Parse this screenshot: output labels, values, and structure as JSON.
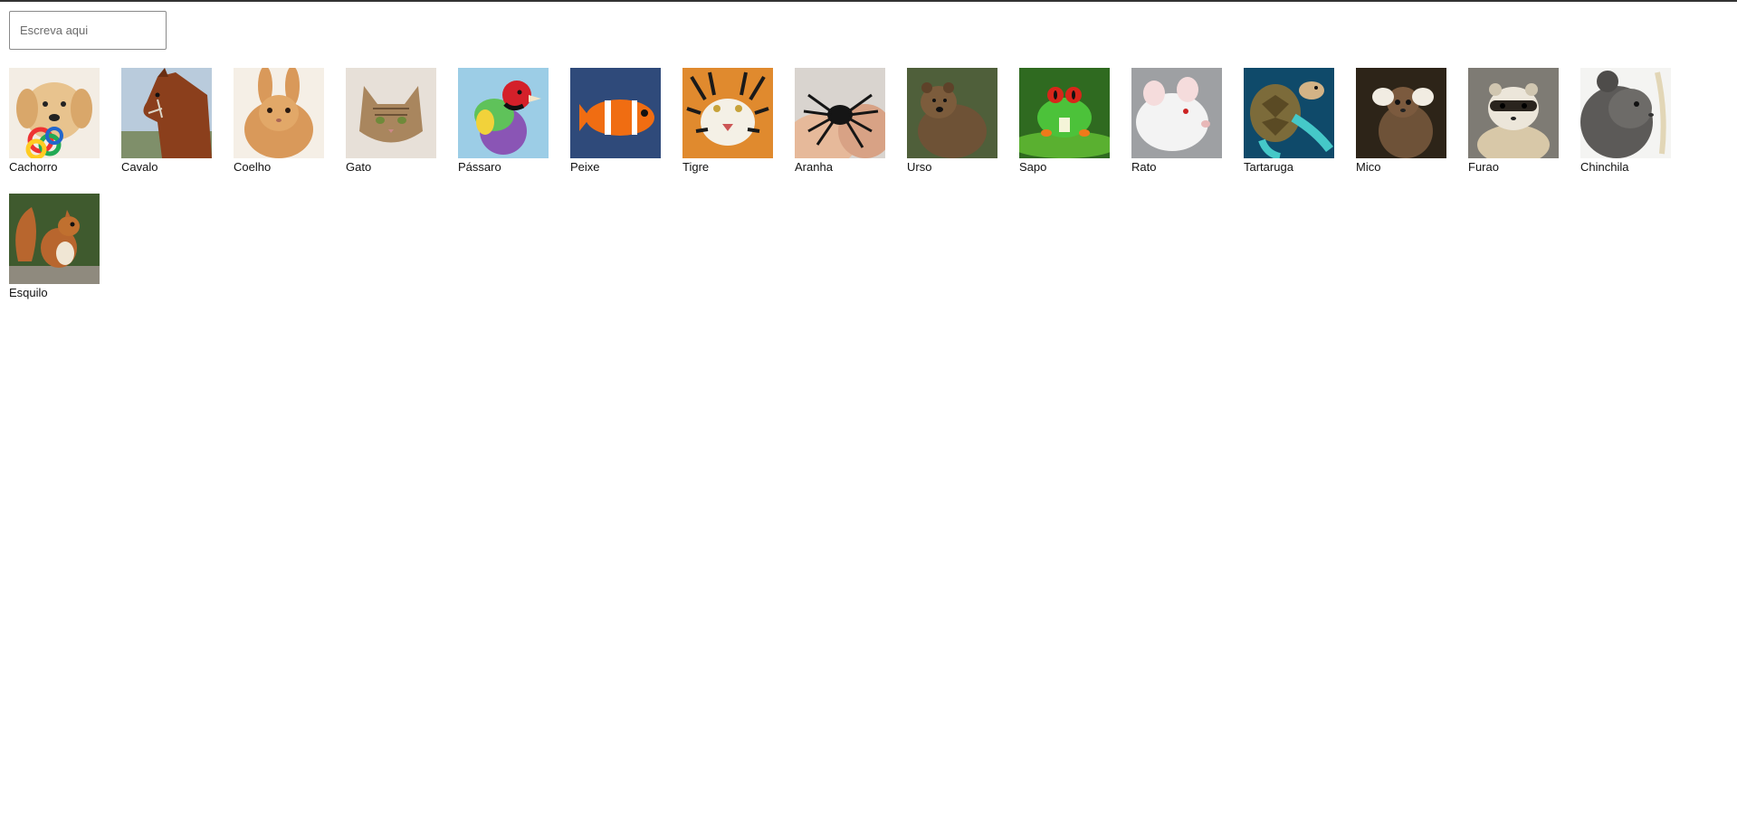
{
  "search": {
    "placeholder": "Escreva aqui",
    "value": ""
  },
  "animals": [
    {
      "label": "Cachorro",
      "icon": "dog-photo-icon"
    },
    {
      "label": "Cavalo",
      "icon": "horse-photo-icon"
    },
    {
      "label": "Coelho",
      "icon": "rabbit-photo-icon"
    },
    {
      "label": "Gato",
      "icon": "cat-photo-icon"
    },
    {
      "label": "Pássaro",
      "icon": "bird-photo-icon"
    },
    {
      "label": "Peixe",
      "icon": "fish-photo-icon"
    },
    {
      "label": "Tigre",
      "icon": "tiger-photo-icon"
    },
    {
      "label": "Aranha",
      "icon": "spider-photo-icon"
    },
    {
      "label": "Urso",
      "icon": "bear-photo-icon"
    },
    {
      "label": "Sapo",
      "icon": "frog-photo-icon"
    },
    {
      "label": "Rato",
      "icon": "rat-photo-icon"
    },
    {
      "label": "Tartaruga",
      "icon": "turtle-photo-icon"
    },
    {
      "label": "Mico",
      "icon": "marmoset-photo-icon"
    },
    {
      "label": "Furao",
      "icon": "ferret-photo-icon"
    },
    {
      "label": "Chinchila",
      "icon": "chinchilla-photo-icon"
    },
    {
      "label": "Esquilo",
      "icon": "squirrel-photo-icon"
    }
  ]
}
